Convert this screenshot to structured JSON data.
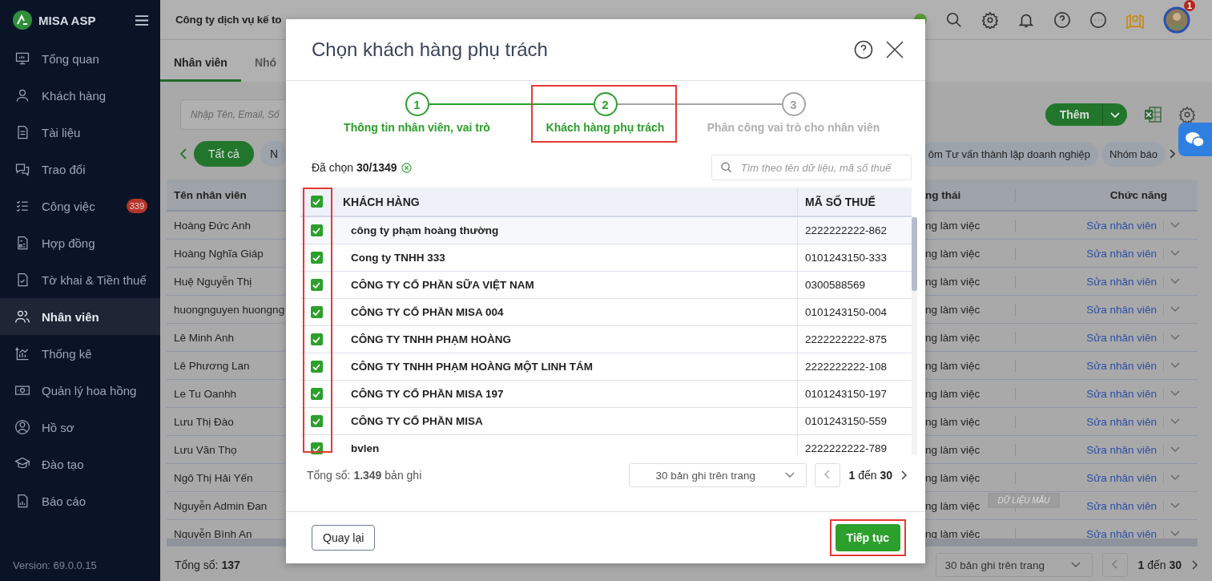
{
  "sidebar": {
    "logo": "MISA ASP",
    "items": [
      {
        "label": "Tổng quan",
        "selected": false
      },
      {
        "label": "Khách hàng",
        "selected": false
      },
      {
        "label": "Tài liệu",
        "selected": false
      },
      {
        "label": "Trao đổi",
        "selected": false
      },
      {
        "label": "Công việc",
        "selected": false,
        "badge": "339"
      },
      {
        "label": "Hợp đồng",
        "selected": false
      },
      {
        "label": "Tờ khai & Tiền thuế",
        "selected": false
      },
      {
        "label": "Nhân viên",
        "selected": true
      },
      {
        "label": "Thống kê",
        "selected": false
      },
      {
        "label": "Quản lý hoa hồng",
        "selected": false
      },
      {
        "label": "Hồ sơ",
        "selected": false
      },
      {
        "label": "Đào tạo",
        "selected": false
      },
      {
        "label": "Báo cáo",
        "selected": false
      }
    ],
    "version": "Version: 69.0.0.15"
  },
  "header": {
    "company": "Công ty dịch vụ kế to",
    "notification_count": "1"
  },
  "tabs": [
    {
      "label": "Nhân viên",
      "selected": true
    },
    {
      "label": "Nhó",
      "selected": false
    }
  ],
  "search": {
    "placeholder": "Nhập Tên, Email, Số"
  },
  "add_button": "Thêm",
  "filter_chips": {
    "left": [
      {
        "label": "Tất cả",
        "selected": true
      },
      {
        "label": "N",
        "selected": false
      }
    ],
    "right": [
      {
        "label": "ôm Tư vấn thành lập doanh nghiệp",
        "selected": false
      },
      {
        "label": "Nhóm báo",
        "selected": false
      }
    ]
  },
  "employee_table": {
    "columns": [
      "Tên nhân viên",
      "ng thái",
      "Chức năng"
    ],
    "rows": [
      {
        "name": "Hoàng Đức Anh",
        "status": "ng làm việc",
        "action": "Sửa nhân viên"
      },
      {
        "name": "Hoàng Nghĩa Giáp",
        "status": "ng làm việc",
        "action": "Sửa nhân viên"
      },
      {
        "name": "Huệ Nguyễn Thị",
        "status": "ng làm việc",
        "action": "Sửa nhân viên"
      },
      {
        "name": "huongnguyen huongng",
        "status": "ng làm việc",
        "action": "Sửa nhân viên"
      },
      {
        "name": "Lê Minh Anh",
        "status": "ng làm việc",
        "action": "Sửa nhân viên"
      },
      {
        "name": "Lê Phương Lan",
        "status": "ng làm việc",
        "action": "Sửa nhân viên"
      },
      {
        "name": "Le Tu Oanhh",
        "status": "ng làm việc",
        "action": "Sửa nhân viên"
      },
      {
        "name": "Lưu Thị Đào",
        "status": "ng làm việc",
        "action": "Sửa nhân viên"
      },
      {
        "name": "Lưu Văn Thọ",
        "status": "ng làm việc",
        "action": "Sửa nhân viên"
      },
      {
        "name": "Ngô Thị Hải Yến",
        "status": "ng làm việc",
        "action": "Sửa nhân viên"
      },
      {
        "name": "Nguyễn Admin Đan",
        "status": "ng làm việc",
        "action": "Sửa nhân viên"
      },
      {
        "name": "Nguyễn Bình An",
        "status": "ng làm việc",
        "action": "Sửa nhân viên"
      }
    ]
  },
  "footer": {
    "total": "Tổng số: **137**",
    "page_size": "30 bản ghi trên trang",
    "range": "**1** đến **30**"
  },
  "sample_stamp": "DỮ LIỆU MẪU",
  "dialog": {
    "title": "Chọn khách hàng phụ trách",
    "steps": [
      {
        "number": "1",
        "label": "Thông tin nhân viên, vai trò",
        "reached": true,
        "highlighted": false
      },
      {
        "number": "2",
        "label": "Khách hàng phụ trách",
        "reached": true,
        "highlighted": true
      },
      {
        "number": "3",
        "label": "Phân công vai trò cho nhân viên",
        "reached": false,
        "highlighted": false
      }
    ],
    "selected_label": "Đã chọn",
    "selected_count": "30/1349",
    "search": {
      "placeholder": "Tìm theo tên dữ liệu, mã số thuế"
    },
    "table": {
      "columns": [
        "KHÁCH HÀNG",
        "MÃ SỐ THUẾ"
      ],
      "select_all_checked": true,
      "checkbox_column_highlighted": true,
      "rows": [
        {
          "name": "công ty phạm hoàng thường",
          "tax_code": "2222222222-862",
          "checked": true
        },
        {
          "name": "Cong ty TNHH 333",
          "tax_code": "0101243150-333",
          "checked": true
        },
        {
          "name": "CÔNG TY CỔ PHẦN SỮA VIỆT NAM",
          "tax_code": "0300588569",
          "checked": true
        },
        {
          "name": "CÔNG TY CỔ PHẦN MISA 004",
          "tax_code": "0101243150-004",
          "checked": true
        },
        {
          "name": "CÔNG TY TNHH PHẠM HOÀNG",
          "tax_code": "2222222222-875",
          "checked": true
        },
        {
          "name": "CÔNG TY TNHH PHẠM HOÀNG MỘT LINH TÁM",
          "tax_code": "2222222222-108",
          "checked": true
        },
        {
          "name": "CÔNG TY CỔ PHẦN MISA 197",
          "tax_code": "0101243150-197",
          "checked": true
        },
        {
          "name": "CÔNG TY CỔ PHẦN MISA",
          "tax_code": "0101243150-559",
          "checked": true
        },
        {
          "name": "bvlen",
          "tax_code": "2222222222-789",
          "checked": true
        }
      ]
    },
    "total": "Tổng số: **1.349** bản ghi",
    "page_size": "30 bản ghi trên trang",
    "range": "**1** đến **30**",
    "buttons": [
      {
        "label": "Quay lại",
        "kind": "secondary",
        "highlighted": false
      },
      {
        "label": "Tiếp tục",
        "kind": "primary",
        "highlighted": true
      }
    ]
  }
}
